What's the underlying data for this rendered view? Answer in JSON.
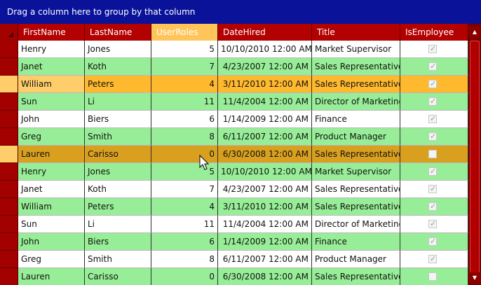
{
  "group_panel": {
    "text": "Drag a column here to group by that column"
  },
  "columns": [
    "FirstName",
    "LastName",
    "UserRoles",
    "DateHired",
    "Title",
    "IsEmployee"
  ],
  "rows": [
    {
      "first": "Henry",
      "last": "Jones",
      "roles": "5",
      "date": "10/10/2010 12:00 AM",
      "title": "Market Supervisor",
      "employee": true,
      "style": "white"
    },
    {
      "first": "Janet",
      "last": "Koth",
      "roles": "7",
      "date": "4/23/2007 12:00 AM",
      "title": "Sales Representative",
      "employee": true,
      "style": "green"
    },
    {
      "first": "William",
      "last": "Peters",
      "roles": "4",
      "date": "3/11/2010 12:00 AM",
      "title": "Sales Representative",
      "employee": true,
      "style": "hi"
    },
    {
      "first": "Sun",
      "last": "Li",
      "roles": "11",
      "date": "11/4/2004 12:00 AM",
      "title": "Director of Marketing",
      "employee": true,
      "style": "green"
    },
    {
      "first": "John",
      "last": "Biers",
      "roles": "6",
      "date": "1/14/2009 12:00 AM",
      "title": "Finance",
      "employee": true,
      "style": "white"
    },
    {
      "first": "Greg",
      "last": "Smith",
      "roles": "8",
      "date": "6/11/2007 12:00 AM",
      "title": "Product Manager",
      "employee": true,
      "style": "green"
    },
    {
      "first": "Lauren",
      "last": "Carisso",
      "roles": "0",
      "date": "6/30/2008 12:00 AM",
      "title": "Sales Representative",
      "employee": false,
      "style": "cur"
    },
    {
      "first": "Henry",
      "last": "Jones",
      "roles": "5",
      "date": "10/10/2010 12:00 AM",
      "title": "Market Supervisor",
      "employee": true,
      "style": "green"
    },
    {
      "first": "Janet",
      "last": "Koth",
      "roles": "7",
      "date": "4/23/2007 12:00 AM",
      "title": "Sales Representative",
      "employee": true,
      "style": "white"
    },
    {
      "first": "William",
      "last": "Peters",
      "roles": "4",
      "date": "3/11/2010 12:00 AM",
      "title": "Sales Representative",
      "employee": true,
      "style": "green"
    },
    {
      "first": "Sun",
      "last": "Li",
      "roles": "11",
      "date": "11/4/2004 12:00 AM",
      "title": "Director of Marketing",
      "employee": true,
      "style": "white"
    },
    {
      "first": "John",
      "last": "Biers",
      "roles": "6",
      "date": "1/14/2009 12:00 AM",
      "title": "Finance",
      "employee": true,
      "style": "green"
    },
    {
      "first": "Greg",
      "last": "Smith",
      "roles": "8",
      "date": "6/11/2007 12:00 AM",
      "title": "Product Manager",
      "employee": true,
      "style": "white"
    },
    {
      "first": "Lauren",
      "last": "Carisso",
      "roles": "0",
      "date": "6/30/2008 12:00 AM",
      "title": "Sales Representative",
      "employee": false,
      "style": "green"
    }
  ],
  "icons": {
    "scroll_up": "triangle-up-icon",
    "scroll_down": "triangle-down-icon",
    "cursor": "mouse-pointer-icon"
  },
  "colors": {
    "group_panel": "#0a129a",
    "header": "#b30000",
    "selected_column": "#ffc55a",
    "row_green": "#98ee98",
    "row_highlight": "#ffb92e",
    "row_current": "#d9a020"
  }
}
